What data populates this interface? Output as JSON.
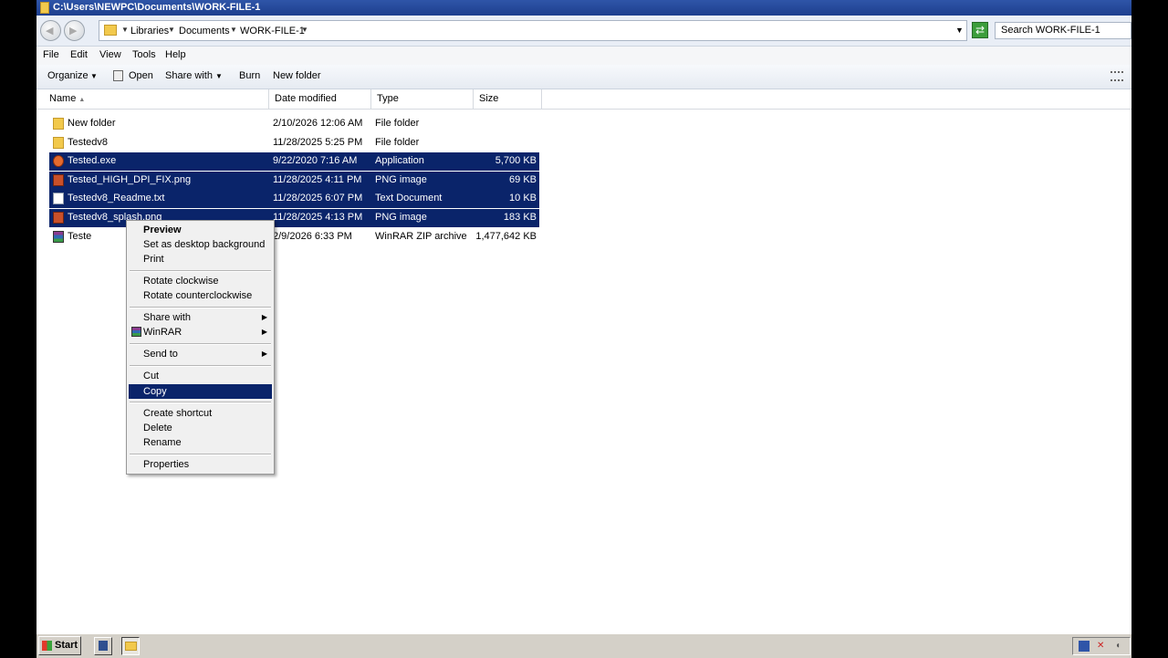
{
  "window": {
    "title": "C:\\Users\\NEWPC\\Documents\\WORK-FILE-1"
  },
  "address": {
    "crumbs": [
      "Libraries",
      "Documents",
      "WORK-FILE-1"
    ],
    "search_placeholder": "Search WORK-FILE-1"
  },
  "menubar": [
    "File",
    "Edit",
    "View",
    "Tools",
    "Help"
  ],
  "toolbar": {
    "organize": "Organize",
    "open": "Open",
    "share_with": "Share with",
    "burn": "Burn",
    "new_folder": "New folder"
  },
  "columns": [
    "Name",
    "Date modified",
    "Type",
    "Size"
  ],
  "files": [
    {
      "name": "New folder",
      "date": "2/10/2026 12:06 AM",
      "type": "File folder",
      "size": "",
      "icon": "folder-icon",
      "selected": false
    },
    {
      "name": "Testedv8",
      "date": "11/28/2025 5:25 PM",
      "type": "File folder",
      "size": "",
      "icon": "folder-icon",
      "selected": false
    },
    {
      "name": "Tested.exe",
      "date": "9/22/2020 7:16 AM",
      "type": "Application",
      "size": "5,700 KB",
      "icon": "application-icon",
      "selected": true
    },
    {
      "name": "Tested_HIGH_DPI_FIX.png",
      "date": "11/28/2025 4:11 PM",
      "type": "PNG image",
      "size": "69 KB",
      "icon": "png-image-icon",
      "selected": true
    },
    {
      "name": "Testedv8_Readme.txt",
      "date": "11/28/2025 6:07 PM",
      "type": "Text Document",
      "size": "10 KB",
      "icon": "text-document-icon",
      "selected": true
    },
    {
      "name": "Testedv8_splash.png",
      "date": "11/28/2025 4:13 PM",
      "type": "PNG image",
      "size": "183 KB",
      "icon": "png-image-icon",
      "selected": true
    },
    {
      "name": "Teste",
      "date": "2/9/2026 6:33 PM",
      "type": "WinRAR ZIP archive",
      "size": "1,477,642 KB",
      "icon": "winrar-archive-icon",
      "selected": false
    }
  ],
  "context_menu": {
    "preview": "Preview",
    "set_desktop": "Set as desktop background",
    "print": "Print",
    "rotate_cw": "Rotate clockwise",
    "rotate_ccw": "Rotate counterclockwise",
    "share_with": "Share with",
    "winrar": "WinRAR",
    "send_to": "Send to",
    "cut": "Cut",
    "copy": "Copy",
    "create_shortcut": "Create shortcut",
    "delete": "Delete",
    "rename": "Rename",
    "properties": "Properties"
  },
  "taskbar": {
    "start": "Start"
  },
  "colors": {
    "selection": "#0a246a",
    "titlebar": "#2f55a8"
  }
}
